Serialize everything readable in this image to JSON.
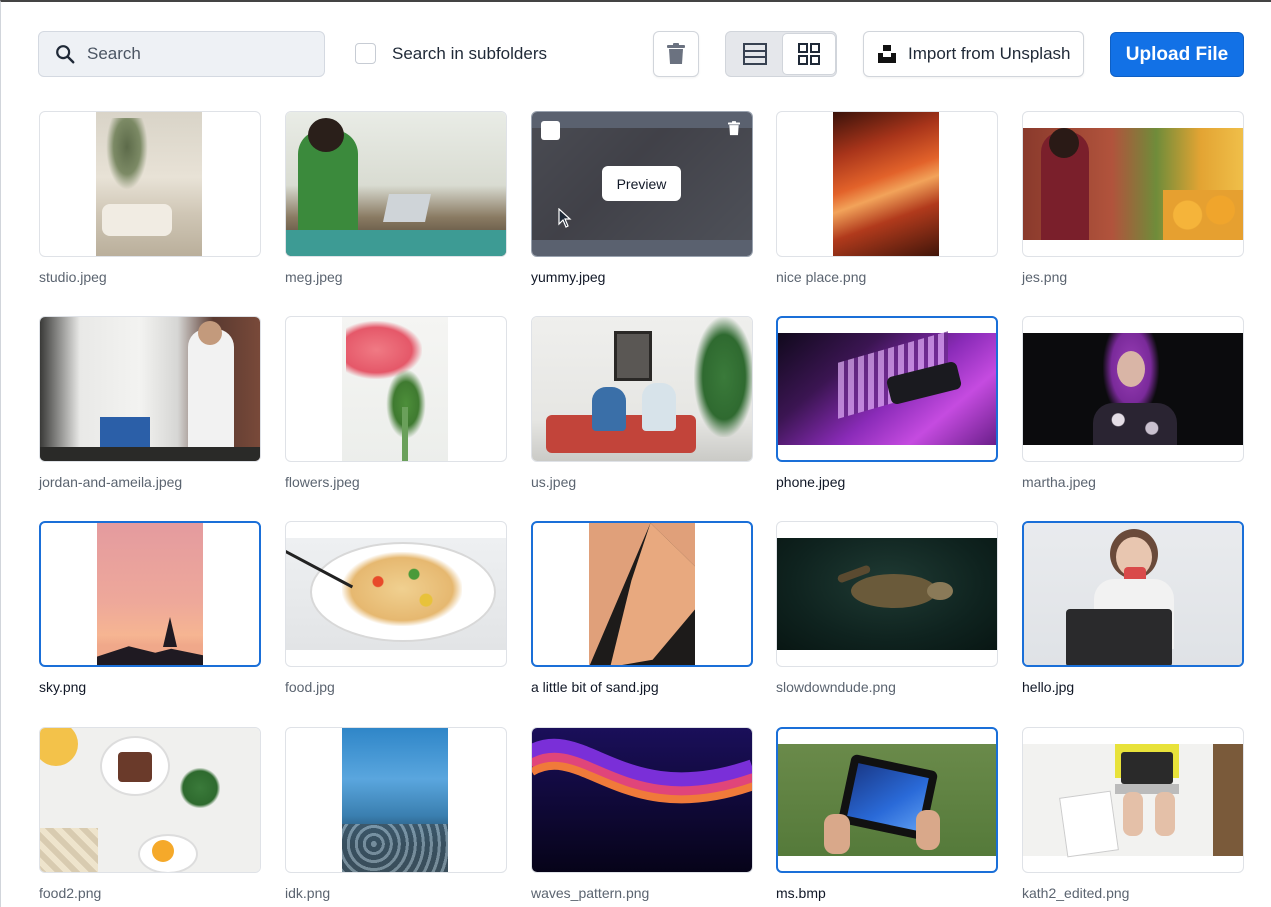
{
  "toolbar": {
    "search_placeholder": "Search",
    "search_value": "",
    "subfolders_label": "Search in subfolders",
    "subfolders_checked": false,
    "unsplash_label": "Import from Unsplash",
    "upload_label": "Upload File",
    "active_view": "grid"
  },
  "accent_color": "#1271e6",
  "hover_preview_label": "Preview",
  "files": [
    {
      "name": "studio.jpeg",
      "selected": false
    },
    {
      "name": "meg.jpeg",
      "selected": false
    },
    {
      "name": "yummy.jpeg",
      "selected": false,
      "hovered": true
    },
    {
      "name": "nice place.png",
      "selected": false
    },
    {
      "name": "jes.png",
      "selected": false
    },
    {
      "name": "jordan-and-ameila.jpeg",
      "selected": false
    },
    {
      "name": "flowers.jpeg",
      "selected": false
    },
    {
      "name": "us.jpeg",
      "selected": false
    },
    {
      "name": "phone.jpeg",
      "selected": true
    },
    {
      "name": "martha.jpeg",
      "selected": false
    },
    {
      "name": "sky.png",
      "selected": true
    },
    {
      "name": "food.jpg",
      "selected": false
    },
    {
      "name": "a little bit of sand.jpg",
      "selected": true
    },
    {
      "name": "slowdowndude.png",
      "selected": false
    },
    {
      "name": "hello.jpg",
      "selected": true
    },
    {
      "name": "food2.png",
      "selected": false
    },
    {
      "name": "idk.png",
      "selected": false
    },
    {
      "name": "waves_pattern.png",
      "selected": false
    },
    {
      "name": "ms.bmp",
      "selected": true
    },
    {
      "name": "kath2_edited.png",
      "selected": false
    }
  ]
}
